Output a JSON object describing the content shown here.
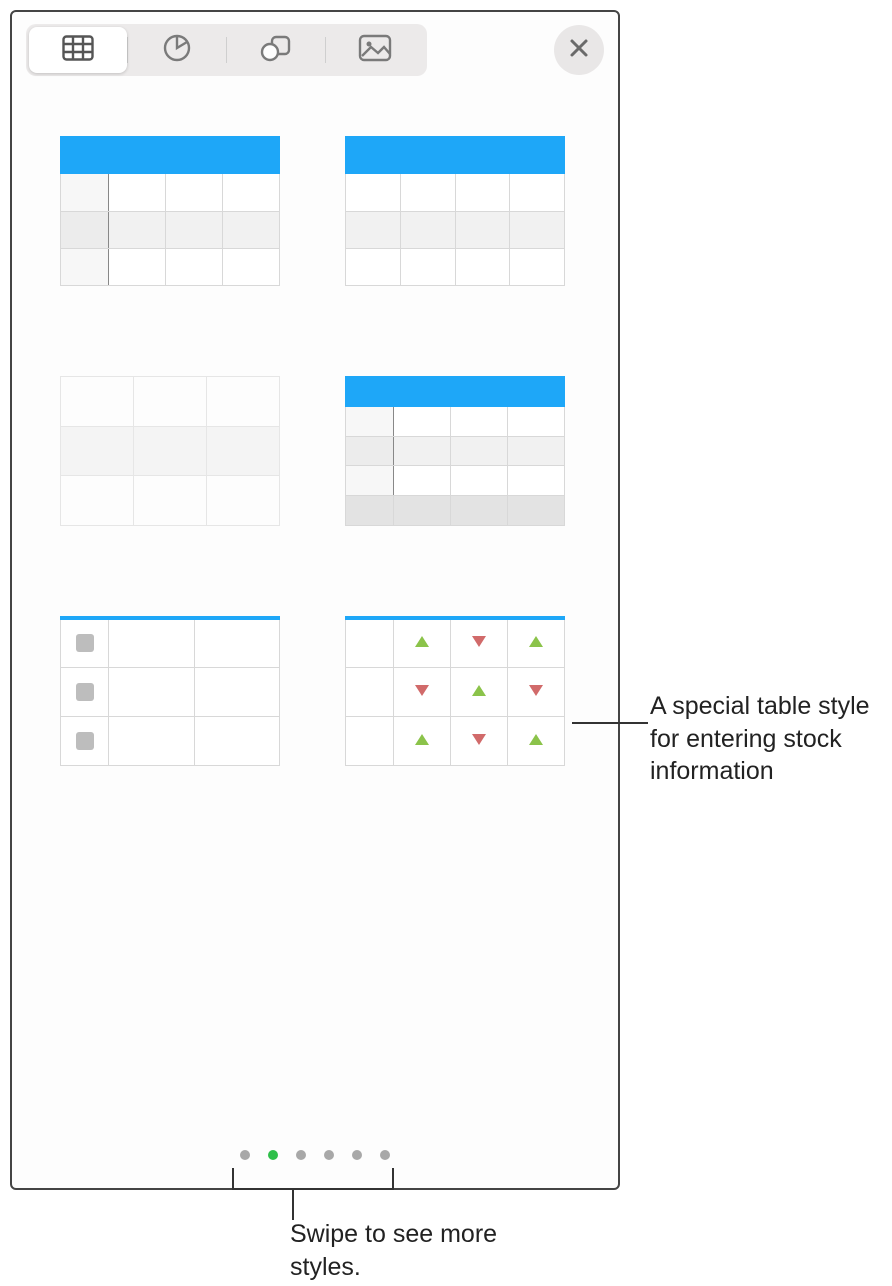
{
  "toolbar": {
    "tabs": [
      {
        "name": "tables",
        "icon": "table-icon",
        "active": true
      },
      {
        "name": "charts",
        "icon": "piechart-icon",
        "active": false
      },
      {
        "name": "shapes",
        "icon": "shapes-icon",
        "active": false
      },
      {
        "name": "media",
        "icon": "image-icon",
        "active": false
      }
    ],
    "close_icon": "close-icon"
  },
  "styles": [
    {
      "id": "blue-header-rowcol",
      "kind": "blue-header",
      "row_header_col": true,
      "alt_rows": true,
      "footer": false,
      "checklist": false,
      "stock": false
    },
    {
      "id": "blue-header",
      "kind": "blue-header",
      "row_header_col": false,
      "alt_rows": true,
      "footer": false,
      "checklist": false,
      "stock": false
    },
    {
      "id": "plain-grid",
      "kind": "plain",
      "row_header_col": false,
      "alt_rows": true,
      "footer": false,
      "checklist": false,
      "stock": false
    },
    {
      "id": "blue-header-footer",
      "kind": "blue-header",
      "row_header_col": true,
      "alt_rows": true,
      "footer": true,
      "checklist": false,
      "stock": false
    },
    {
      "id": "blue-header-checklist",
      "kind": "blue-header",
      "row_header_col": false,
      "alt_rows": false,
      "footer": false,
      "checklist": true,
      "stock": false
    },
    {
      "id": "blue-header-stock",
      "kind": "blue-header",
      "row_header_col": false,
      "alt_rows": false,
      "footer": false,
      "checklist": false,
      "stock": true
    }
  ],
  "stock_pattern": [
    [
      "up",
      "down",
      "up"
    ],
    [
      "down",
      "up",
      "down"
    ],
    [
      "up",
      "down",
      "up"
    ]
  ],
  "pagination": {
    "total": 6,
    "active_index": 1
  },
  "callouts": {
    "stock": "A special table style for entering stock information",
    "swipe": "Swipe to see more styles."
  },
  "colors": {
    "header_blue": "#1ea7f8",
    "dot_active": "#2fbf4a"
  }
}
